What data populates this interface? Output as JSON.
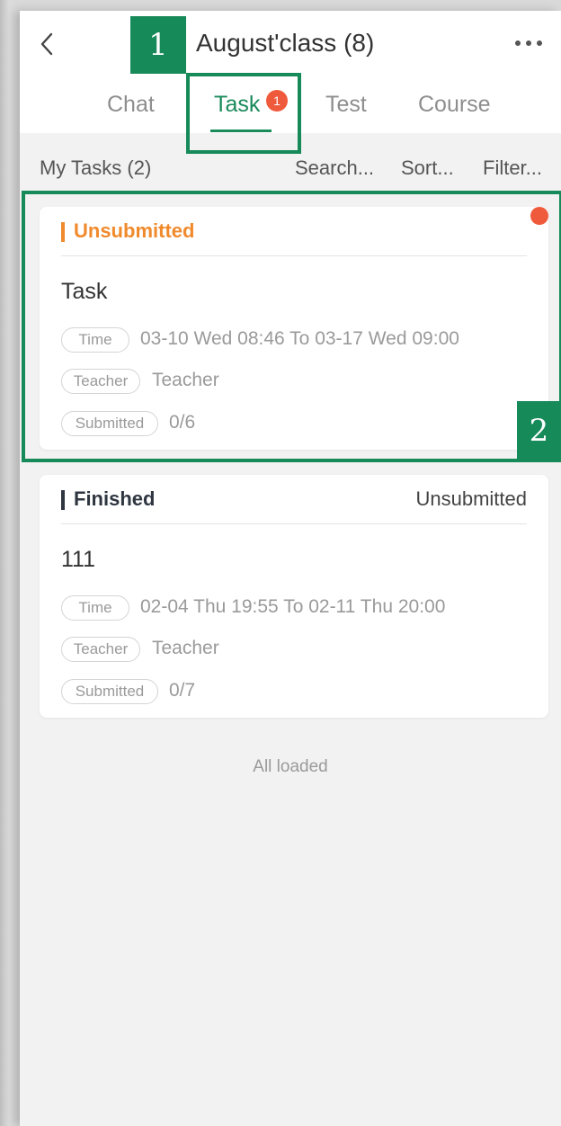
{
  "header": {
    "title": "August'class (8)",
    "back_icon": "chevron-left-icon",
    "more_icon": "more-horizontal-icon"
  },
  "tabs": [
    {
      "label": "Chat",
      "active": false
    },
    {
      "label": "Task",
      "active": true,
      "badge": "1"
    },
    {
      "label": "Test",
      "active": false
    },
    {
      "label": "Course",
      "active": false
    }
  ],
  "filterbar": {
    "my_tasks": "My Tasks (2)",
    "search": "Search...",
    "sort": "Sort...",
    "filter": "Filter..."
  },
  "tasks": [
    {
      "status": "Unsubmitted",
      "status_color": "#f08a2c",
      "status_right": "",
      "unread_dot": true,
      "title": "Task",
      "time_label": "Time",
      "time_value": "03-10 Wed 08:46 To 03-17 Wed 09:00",
      "teacher_label": "Teacher",
      "teacher_value": "Teacher",
      "submitted_label": "Submitted",
      "submitted_value": "0/6"
    },
    {
      "status": "Finished",
      "status_color": "#2f3640",
      "status_right": "Unsubmitted",
      "unread_dot": false,
      "title": "111",
      "time_label": "Time",
      "time_value": "02-04 Thu 19:55 To 02-11 Thu 20:00",
      "teacher_label": "Teacher",
      "teacher_value": "Teacher",
      "submitted_label": "Submitted",
      "submitted_value": "0/7"
    }
  ],
  "footer": {
    "all_loaded": "All loaded"
  },
  "annotations": {
    "label_1": "1",
    "label_2": "2",
    "color": "#178a5a"
  },
  "colors": {
    "accent": "#1a8a5b",
    "badge": "#f05a3c"
  }
}
